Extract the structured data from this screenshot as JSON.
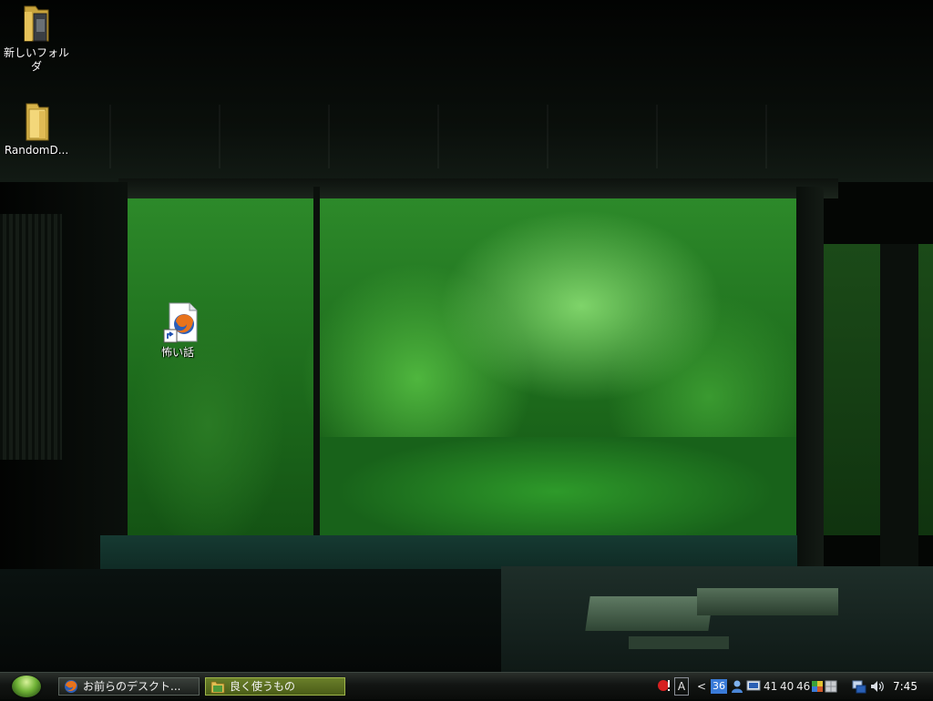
{
  "desktop": {
    "icons": [
      {
        "label": "新しいフォルダ",
        "icon": "folder-icon"
      },
      {
        "label": "RandomD...",
        "icon": "folder-icon"
      },
      {
        "label": "怖い話",
        "icon": "firefox-document-shortcut-icon"
      }
    ]
  },
  "taskbar": {
    "start": {
      "icon": "start-orb-icon"
    },
    "buttons": [
      {
        "label": "お前らのデスクト...",
        "icon": "firefox-icon",
        "active": false
      },
      {
        "label": "良く使うもの",
        "icon": "folder-icon",
        "active": true
      }
    ],
    "tray": {
      "icons": [
        "alert-icon",
        "ime-a-icon",
        "show-hidden-icon",
        "badge-36-icon",
        "user-icon",
        "monitor-icon",
        "network-icon",
        "volume-icon"
      ],
      "badge_value": "36",
      "show_hidden_glyph": "<",
      "ime_label": "A",
      "readings": [
        "41",
        "40",
        "46"
      ],
      "clock": "7:45"
    }
  },
  "colors": {
    "taskbar_bg": "#121513",
    "active_task_bg": "#5a6d20",
    "label_text": "#ffffff"
  }
}
